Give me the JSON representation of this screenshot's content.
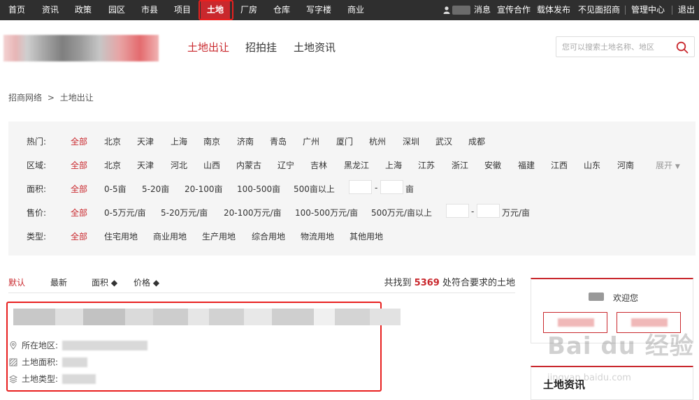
{
  "topnav": {
    "left": [
      "首页",
      "资讯",
      "政策",
      "园区",
      "市县",
      "项目",
      "土地",
      "厂房",
      "仓库",
      "写字楼",
      "商业"
    ],
    "right": [
      "消息",
      "宣传合作",
      "载体发布",
      "不见面招商",
      "管理中心",
      "退出"
    ]
  },
  "header": {
    "tabs": [
      "土地出让",
      "招拍挂",
      "土地资讯"
    ],
    "search_placeholder": "您可以搜索土地名称、地区"
  },
  "breadcrumb": {
    "home": "招商网络",
    "sep": ">",
    "current": "土地出让"
  },
  "filters": {
    "hot": {
      "label": "热门:",
      "options": [
        "全部",
        "北京",
        "天津",
        "上海",
        "南京",
        "济南",
        "青岛",
        "广州",
        "厦门",
        "杭州",
        "深圳",
        "武汉",
        "成都"
      ]
    },
    "region": {
      "label": "区域:",
      "options": [
        "全部",
        "北京",
        "天津",
        "河北",
        "山西",
        "内蒙古",
        "辽宁",
        "吉林",
        "黑龙江",
        "上海",
        "江苏",
        "浙江",
        "安徽",
        "福建",
        "江西",
        "山东",
        "河南"
      ],
      "expand": "展开"
    },
    "area": {
      "label": "面积:",
      "options": [
        "全部",
        "0-5亩",
        "5-20亩",
        "20-100亩",
        "100-500亩",
        "500亩以上"
      ],
      "dash": "-",
      "unit": "亩"
    },
    "price": {
      "label": "售价:",
      "options": [
        "全部",
        "0-5万元/亩",
        "5-20万元/亩",
        "20-100万元/亩",
        "100-500万元/亩",
        "500万元/亩以上"
      ],
      "dash": "-",
      "unit": "万元/亩"
    },
    "type": {
      "label": "类型:",
      "options": [
        "全部",
        "住宅用地",
        "商业用地",
        "生产用地",
        "综合用地",
        "物流用地",
        "其他用地"
      ]
    }
  },
  "sort": {
    "items": [
      "默认",
      "最新",
      "面积 ◆",
      "价格 ◆"
    ],
    "result_prefix": "共找到",
    "result_count": "5369",
    "result_suffix": "处符合要求的土地"
  },
  "listing": {
    "location_label": "所在地区:",
    "area_label": "土地面积:",
    "type_label": "土地类型:"
  },
  "sidebar": {
    "welcome": "欢迎您",
    "news_title": "土地资讯"
  },
  "watermark": {
    "main": "Bai du 经验",
    "sub": "jingyan.baidu.com"
  },
  "colors": {
    "accent": "#c9282d",
    "topbar": "#2f2f2f",
    "panel": "#f5f5f5"
  }
}
